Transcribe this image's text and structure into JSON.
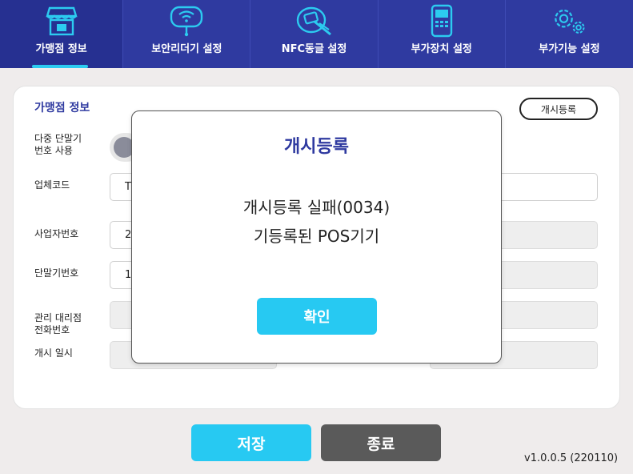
{
  "nav": {
    "tabs": [
      {
        "label": "가맹점 정보",
        "icon": "store-icon",
        "active": true
      },
      {
        "label": "보안리더기 설정",
        "icon": "wifi-reader-icon",
        "active": false
      },
      {
        "label": "NFC동글 설정",
        "icon": "nfc-card-icon",
        "active": false
      },
      {
        "label": "부가장치 설정",
        "icon": "device-icon",
        "active": false
      },
      {
        "label": "부가기능 설정",
        "icon": "gears-icon",
        "active": false
      }
    ]
  },
  "colors": {
    "nav_bg": "#2f3aa0",
    "accent": "#27c9f2",
    "title": "#2f3aa0",
    "close_btn": "#5a5a5a"
  },
  "form": {
    "section_title": "가맹점 정보",
    "register_button": "개시등록",
    "multi_terminal_label_line1": "다중 단말기",
    "multi_terminal_label_line2": "번호 사용",
    "business_code_label": "업체코드",
    "business_code_value": "T",
    "business_number_label": "사업자번호",
    "business_number_value": "2",
    "terminal_number_label": "단말기번호",
    "terminal_number_value": "1",
    "agency_phone_label_line1": "관리 대리점",
    "agency_phone_label_line2": "전화번호",
    "open_datetime_label": "개시 일시"
  },
  "modal": {
    "title": "개시등록",
    "message_line1": "개시등록 실패(0034)",
    "message_line2": "기등록된 POS기기",
    "ok_button": "확인"
  },
  "footer": {
    "save_button": "저장",
    "close_button": "종료",
    "version": "v1.0.0.5 (220110)"
  }
}
